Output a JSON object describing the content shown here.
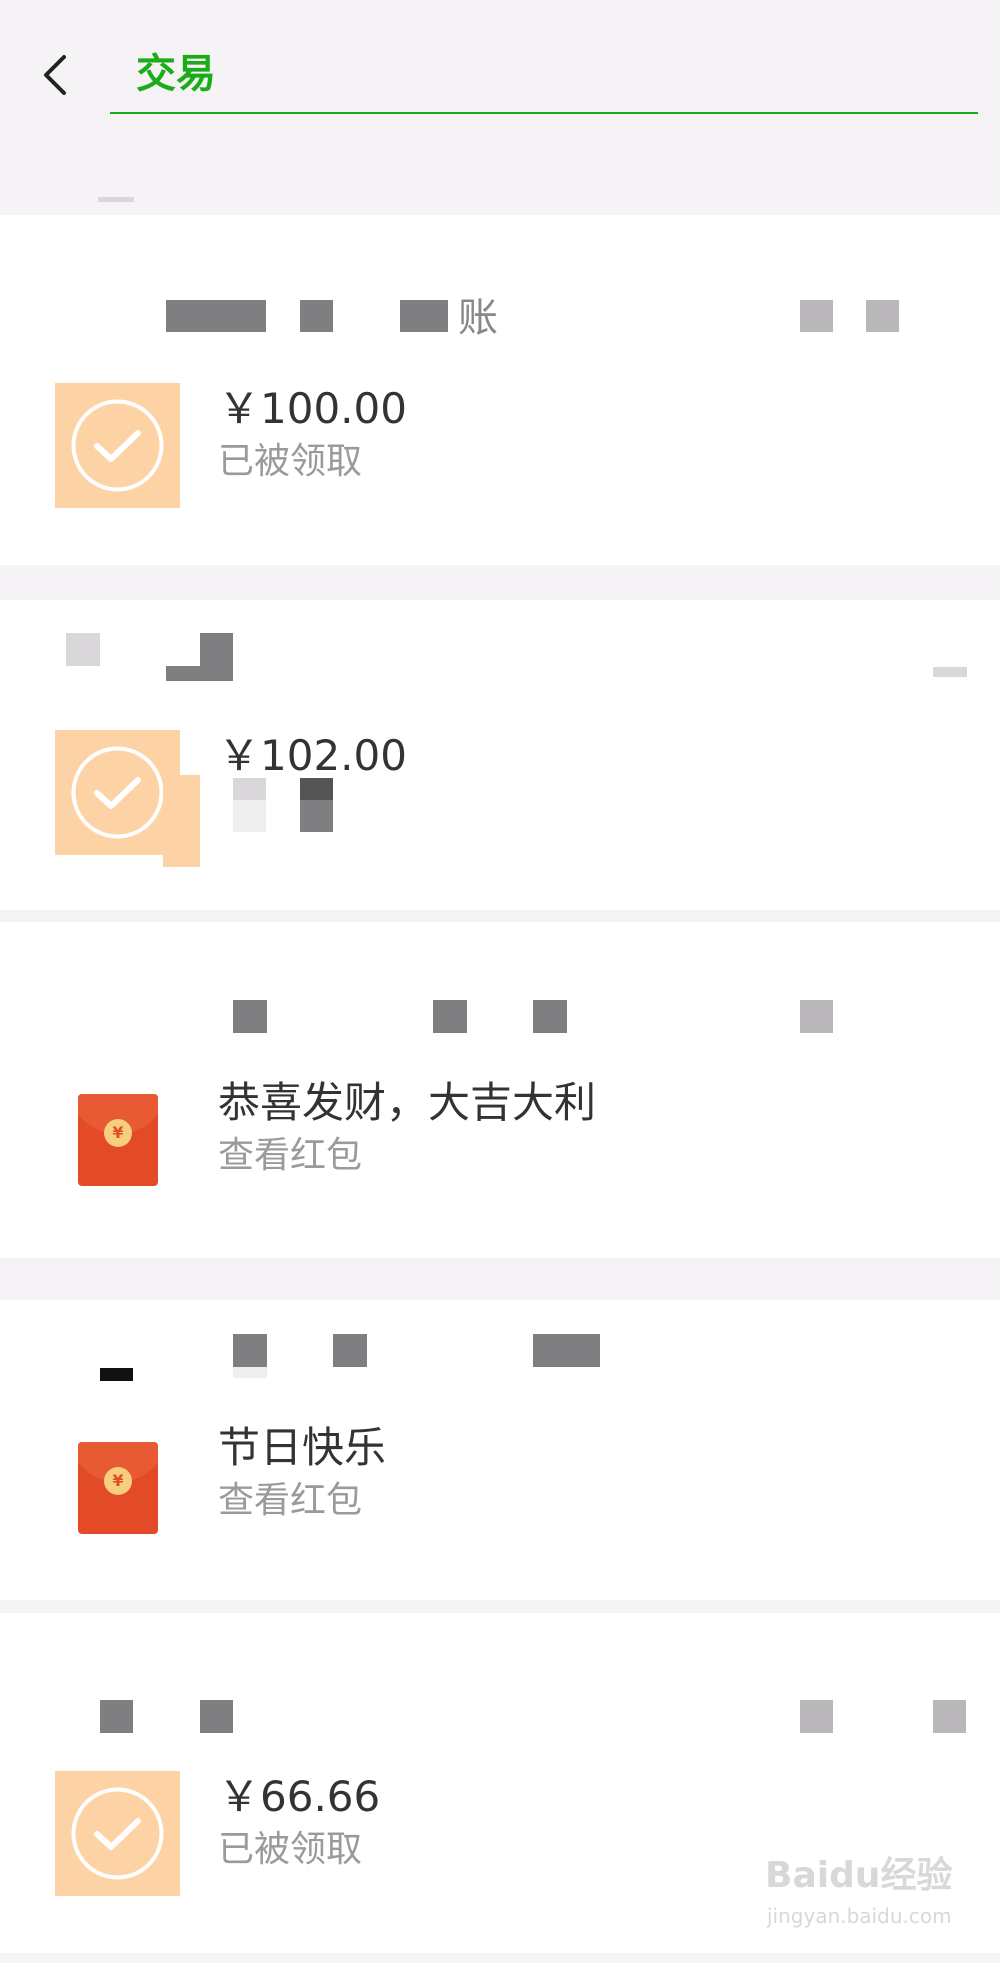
{
  "header": {
    "search_value": "交易"
  },
  "transactions": [
    {
      "title": "账",
      "amount": "￥100.00",
      "status": "已被领取",
      "icon": "check-circle-icon"
    },
    {
      "amount": "￥102.00",
      "icon": "check-circle-icon"
    },
    {
      "message": "恭喜发财，大吉大利",
      "action": "查看红包",
      "icon": "red-packet-icon"
    },
    {
      "message": "节日快乐",
      "action": "查看红包",
      "icon": "red-packet-icon"
    },
    {
      "amount": "￥66.66",
      "status": "已被领取",
      "icon": "check-circle-icon"
    }
  ],
  "red_packet_coin": "¥",
  "watermark": {
    "brand": "Baidu经验",
    "url": "jingyan.baidu.com"
  },
  "colors": {
    "accent": "#1aad19",
    "transfer_icon_bg": "#fdd3a6",
    "red_packet": "#e34a28",
    "background": "#f6f3f6"
  }
}
